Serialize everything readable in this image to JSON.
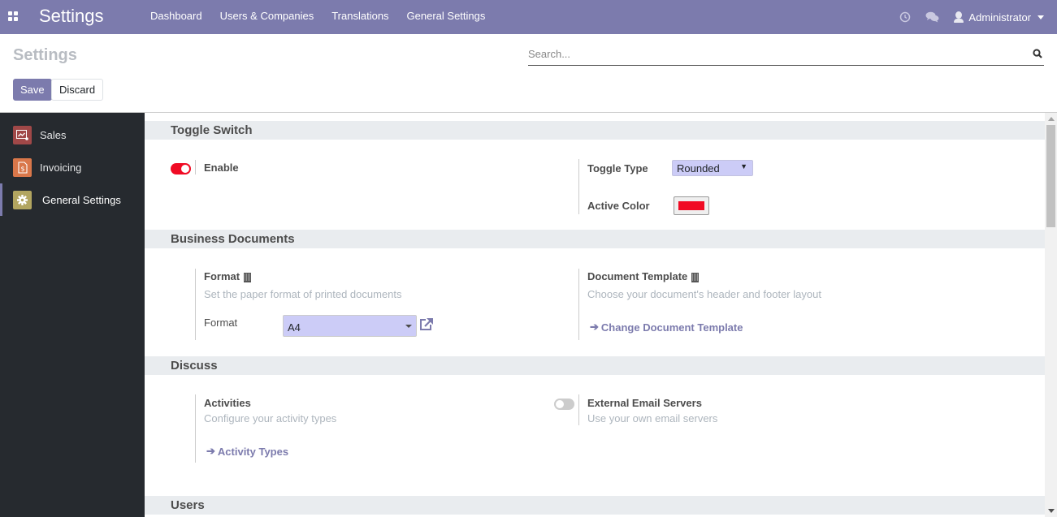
{
  "navbar": {
    "app_title": "Settings",
    "menu": [
      "Dashboard",
      "Users & Companies",
      "Translations",
      "General Settings"
    ],
    "user": "Administrator",
    "bg_color": "#7c7bad"
  },
  "control_panel": {
    "title": "Settings",
    "search_placeholder": "Search...",
    "search_value": "",
    "save_label": "Save",
    "discard_label": "Discard"
  },
  "sidebar": {
    "items": [
      {
        "label": "Sales",
        "icon": "sales-chart-icon",
        "color": "#a04848",
        "active": false
      },
      {
        "label": "Invoicing",
        "icon": "invoice-dollar-icon",
        "color": "#d9774a",
        "active": false
      },
      {
        "label": "General Settings",
        "icon": "gear-icon",
        "color": "#b2a560",
        "active": true
      }
    ]
  },
  "sections": {
    "toggle_switch": {
      "title": "Toggle Switch",
      "enable_label": "Enable",
      "enable_on": true,
      "toggle_type_label": "Toggle Type",
      "toggle_type_value": "Rounded",
      "active_color_label": "Active Color",
      "active_color": "#f00b24"
    },
    "business_documents": {
      "title": "Business Documents",
      "format_title": "Format",
      "format_desc": "Set the paper format of printed documents",
      "format_field_label": "Format",
      "format_value": "A4",
      "template_title": "Document Template",
      "template_desc": "Choose your document's header and footer layout",
      "template_link": "Change Document Template"
    },
    "discuss": {
      "title": "Discuss",
      "activities_title": "Activities",
      "activities_desc": "Configure your activity types",
      "activities_link": "Activity Types",
      "email_title": "External Email Servers",
      "email_desc": "Use your own email servers",
      "email_on": false
    },
    "users": {
      "title": "Users"
    }
  }
}
